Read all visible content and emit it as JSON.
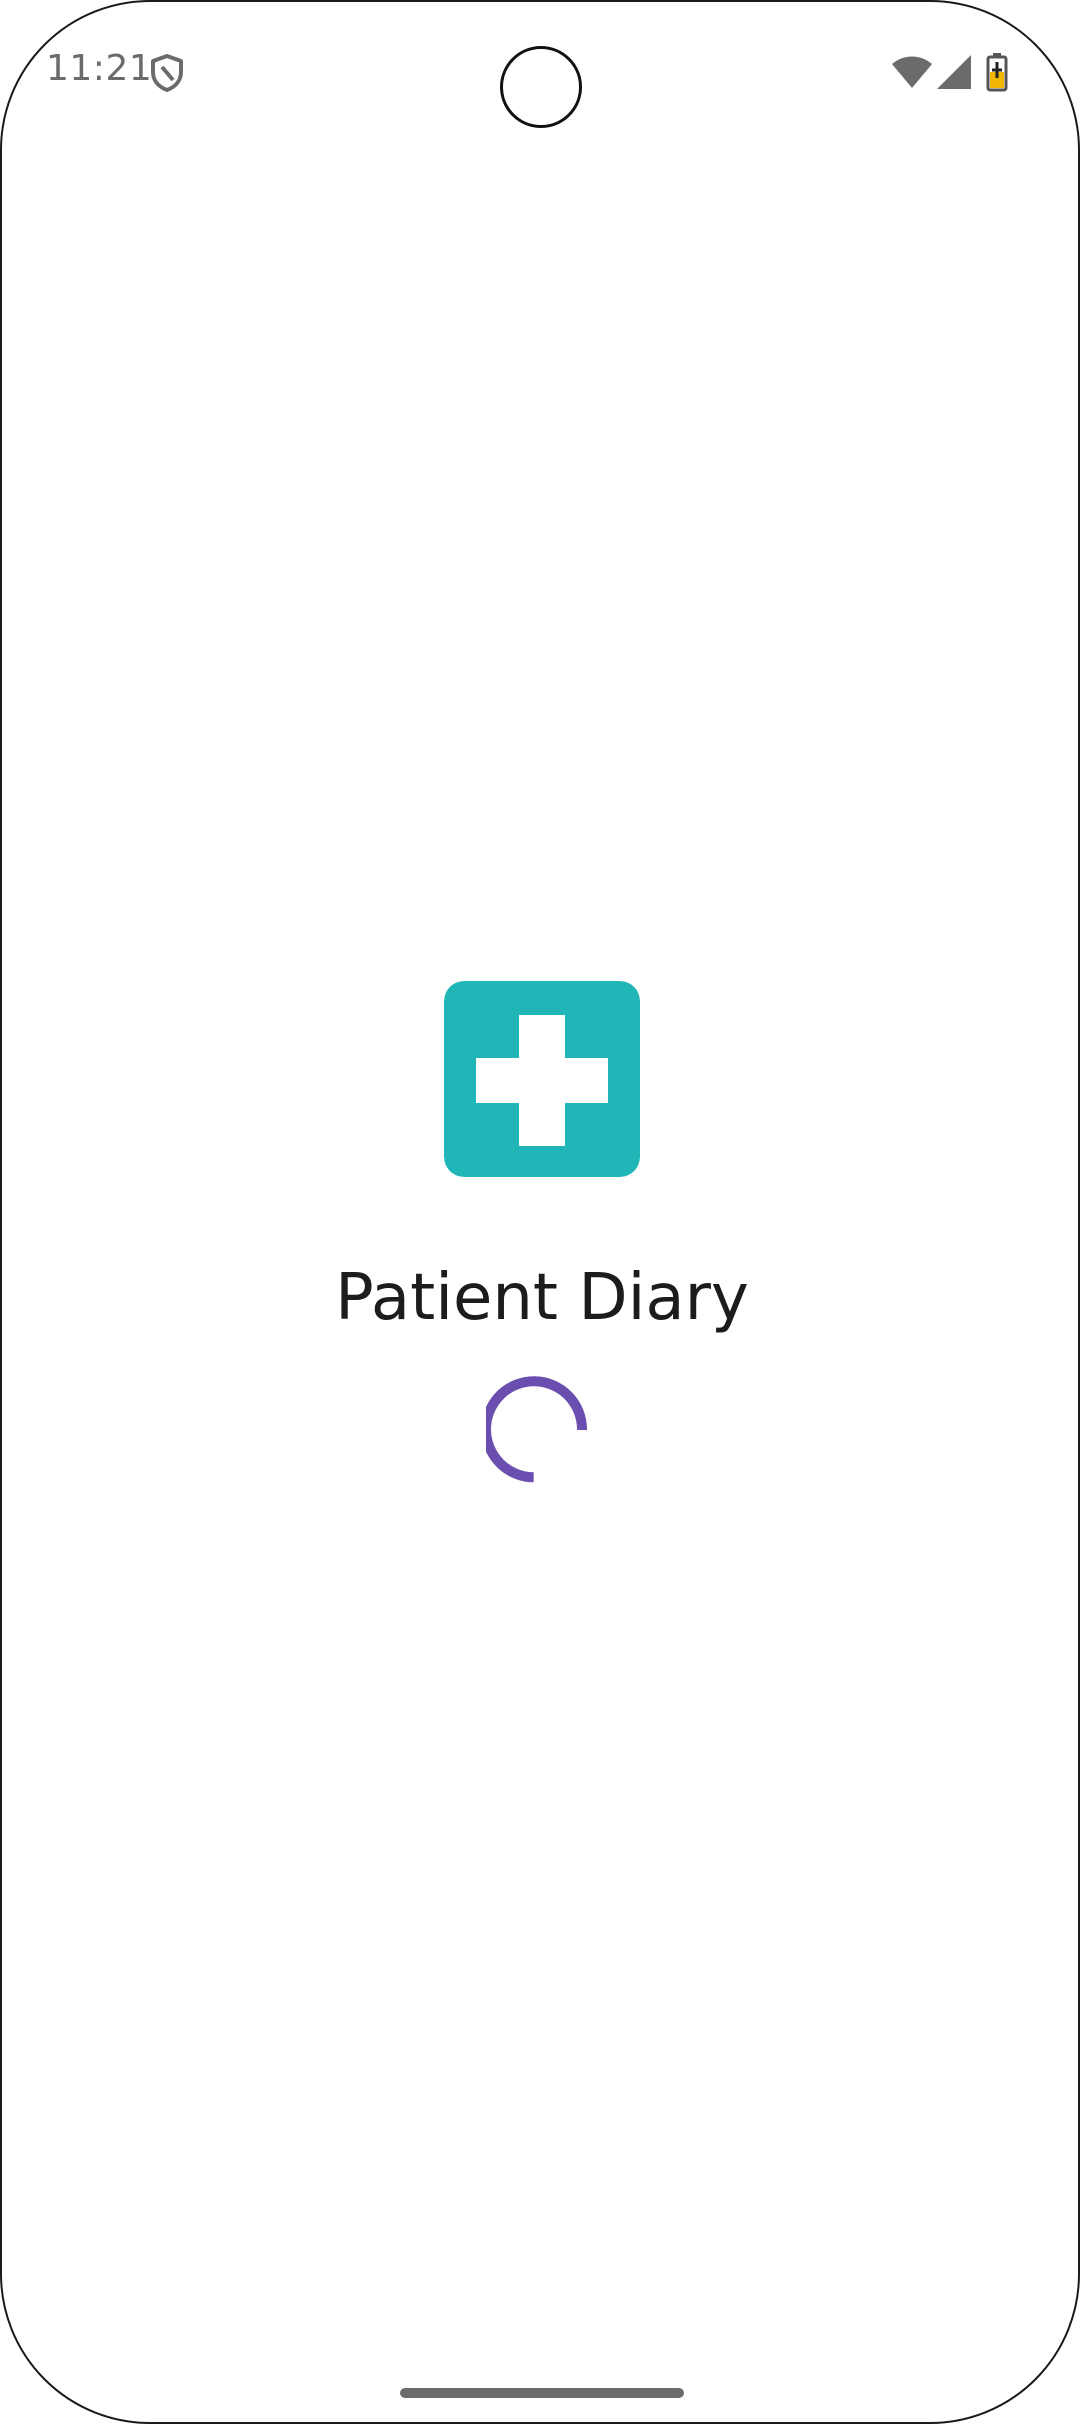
{
  "status_bar": {
    "time": "11:21",
    "icons": [
      "shield-icon",
      "wifi-icon",
      "signal-icon",
      "battery-icon"
    ],
    "icon_color": "#6b6b6b",
    "battery_fill_color": "#f2b705"
  },
  "splash": {
    "logo_icon": "medical-cross-icon",
    "logo_color": "#20b6b8",
    "title": "Patient Diary",
    "spinner_color": "#6a4fb0"
  }
}
